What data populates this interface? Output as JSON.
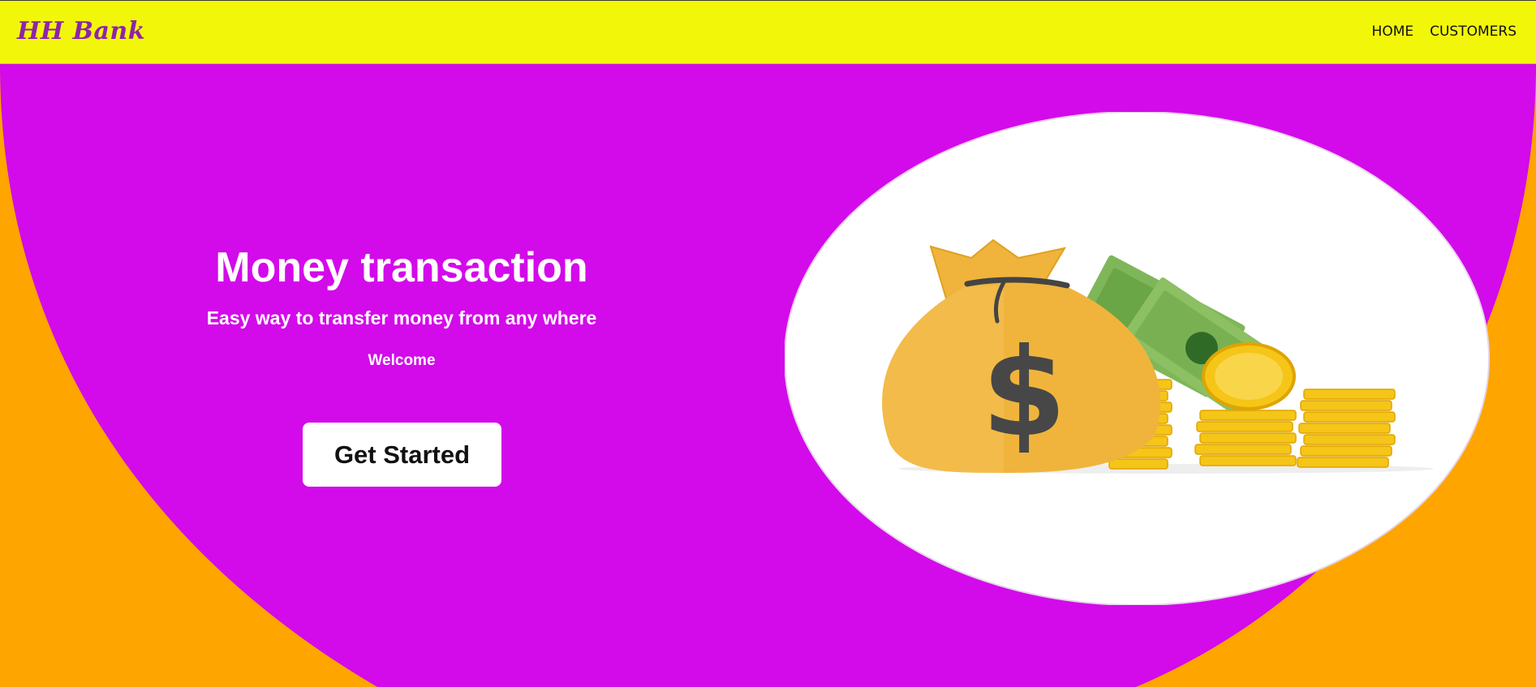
{
  "navbar": {
    "brand": "HH Bank",
    "links": [
      {
        "label": "HOME"
      },
      {
        "label": "CUSTOMERS"
      }
    ]
  },
  "hero": {
    "title": "Money transaction",
    "subtitle": "Easy way to transfer money from any where",
    "welcome": "Welcome",
    "cta_label": "Get Started",
    "illustration_icon": "money-bag-icon",
    "illustration_symbol": "$"
  },
  "colors": {
    "navbar_bg": "#F2F70A",
    "brand": "#8E24AA",
    "hero_purple": "#D30AEA",
    "page_orange": "#FFA500",
    "bag_gold": "#F0B43C",
    "coin_gold": "#F5C518",
    "cash_green": "#8CC063"
  }
}
